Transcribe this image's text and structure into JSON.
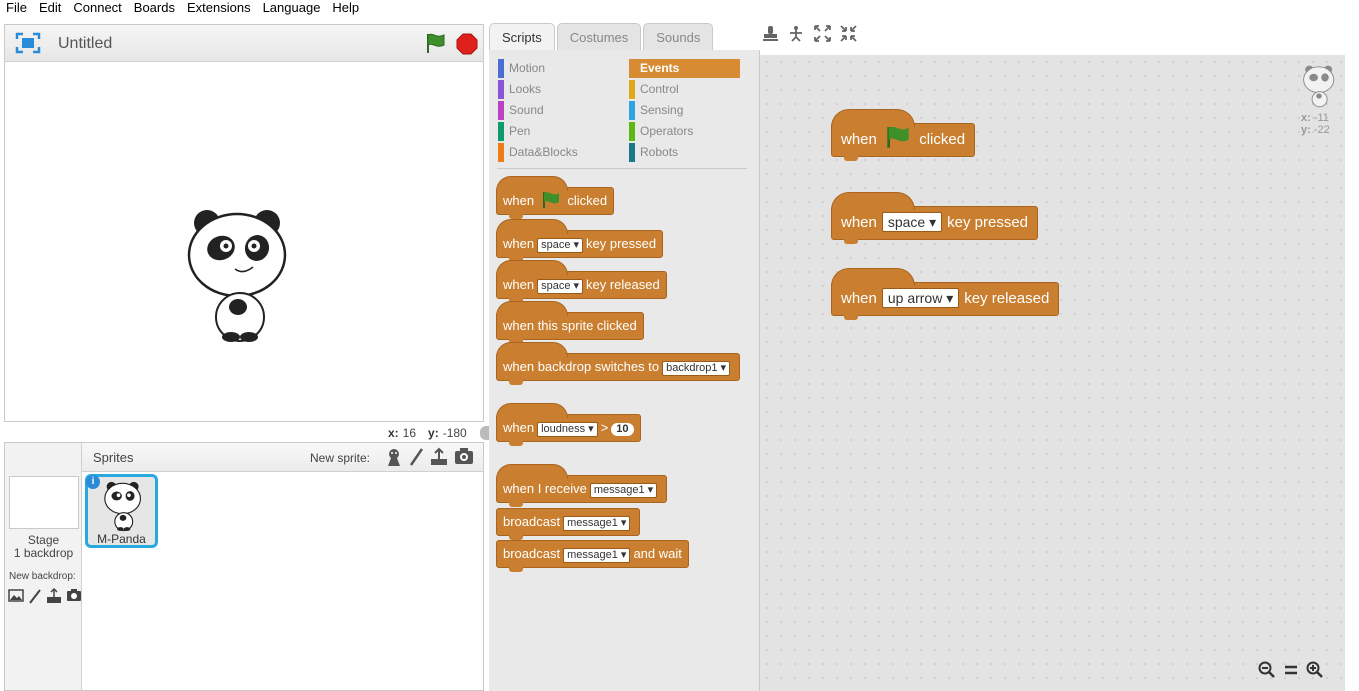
{
  "menu": [
    "File",
    "Edit",
    "Connect",
    "Boards",
    "Extensions",
    "Language",
    "Help"
  ],
  "stage": {
    "title": "Untitled",
    "x_label": "x:",
    "x_value": "16",
    "y_label": "y:",
    "y_value": "-180"
  },
  "sprites": {
    "title": "Sprites",
    "new_sprite_label": "New sprite:",
    "stage_label": "Stage",
    "stage_sub": "1 backdrop",
    "new_backdrop_label": "New backdrop:",
    "selected_sprite_name": "M-Panda",
    "info_glyph": "i"
  },
  "tabs": [
    "Scripts",
    "Costumes",
    "Sounds"
  ],
  "categories": {
    "left": [
      "Motion",
      "Looks",
      "Sound",
      "Pen",
      "Data&Blocks"
    ],
    "right": [
      "Events",
      "Control",
      "Sensing",
      "Operators",
      "Robots"
    ],
    "colors": {
      "Motion": "#4a6cd4",
      "Looks": "#8a55d7",
      "Sound": "#bb42c3",
      "Pen": "#0e9a6c",
      "Data&Blocks": "#ee7d16",
      "Events": "#c88330",
      "Control": "#e1a91a",
      "Sensing": "#2ca5e2",
      "Operators": "#5cb712",
      "Robots": "#1a7a8a"
    }
  },
  "palette_blocks": {
    "b1": {
      "when": "when",
      "clicked": "clicked"
    },
    "b2": {
      "when": "when",
      "key": "space",
      "rest": "key pressed"
    },
    "b3": {
      "when": "when",
      "key": "space",
      "rest": "key released"
    },
    "b4": {
      "text": "when this sprite clicked"
    },
    "b5": {
      "text": "when backdrop switches to",
      "value": "backdrop1"
    },
    "b6": {
      "when": "when",
      "sensor": "loudness",
      "op": ">",
      "num": "10"
    },
    "b7": {
      "text": "when I receive",
      "value": "message1"
    },
    "b8": {
      "text": "broadcast",
      "value": "message1"
    },
    "b9": {
      "text": "broadcast",
      "value": "message1",
      "rest": "and wait"
    }
  },
  "script_blocks": {
    "s1": {
      "when": "when",
      "clicked": "clicked"
    },
    "s2": {
      "when": "when",
      "key": "space",
      "rest": "key pressed"
    },
    "s3": {
      "when": "when",
      "key": "up arrow",
      "rest": "key released"
    }
  },
  "script_area": {
    "x_label": "x:",
    "x_value": "-11",
    "y_label": "y:",
    "y_value": "-22"
  }
}
